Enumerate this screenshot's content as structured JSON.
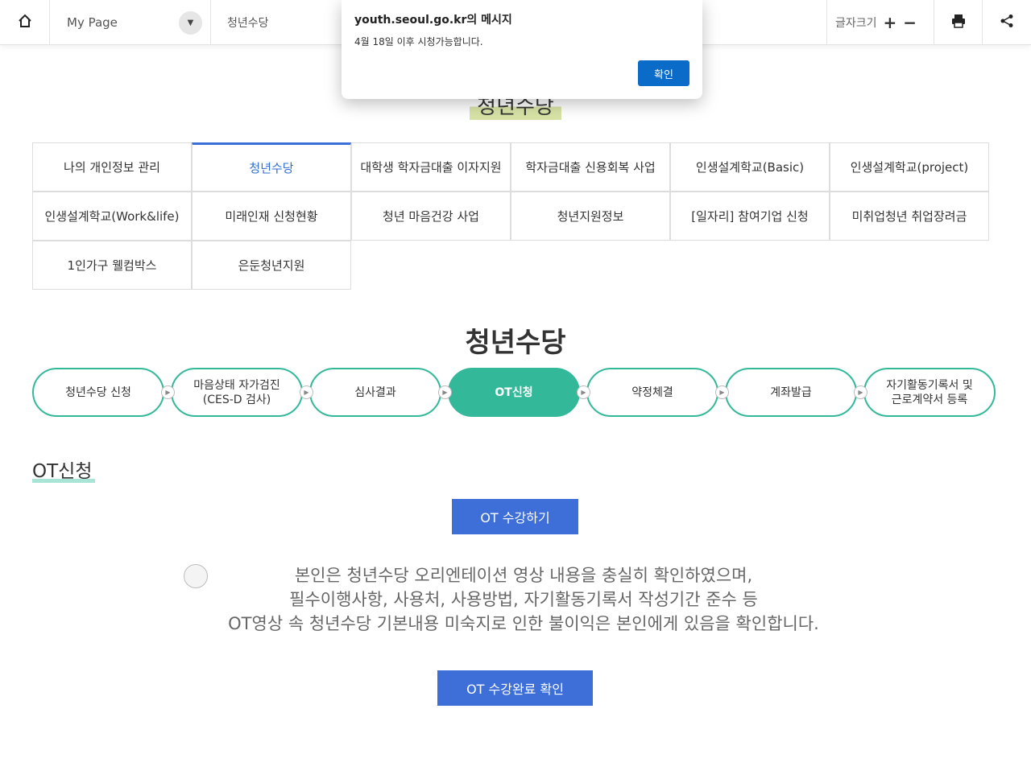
{
  "topbar": {
    "mypage_label": "My Page",
    "sub_label": "청년수당",
    "fontsize_label": "글자크기",
    "plus": "+",
    "minus": "−"
  },
  "page_title": "청년수당",
  "menu": [
    {
      "label": "나의 개인정보 관리",
      "active": false
    },
    {
      "label": "청년수당",
      "active": true
    },
    {
      "label": "대학생 학자금대출 이자지원",
      "active": false
    },
    {
      "label": "학자금대출 신용회복 사업",
      "active": false
    },
    {
      "label": "인생설계학교(Basic)",
      "active": false
    },
    {
      "label": "인생설계학교(project)",
      "active": false
    },
    {
      "label": "인생설계학교(Work&life)",
      "active": false
    },
    {
      "label": "미래인재 신청현황",
      "active": false
    },
    {
      "label": "청년 마음건강 사업",
      "active": false
    },
    {
      "label": "청년지원정보",
      "active": false
    },
    {
      "label": "[일자리] 참여기업 신청",
      "active": false
    },
    {
      "label": "미취업청년 취업장려금",
      "active": false
    },
    {
      "label": "1인가구 웰컴박스",
      "active": false
    },
    {
      "label": "은둔청년지원",
      "active": false
    }
  ],
  "section_title": "청년수당",
  "steps": [
    {
      "line1": "청년수당 신청",
      "line2": "",
      "active": false
    },
    {
      "line1": "마음상태 자가검진",
      "line2": "(CES-D 검사)",
      "active": false
    },
    {
      "line1": "심사결과",
      "line2": "",
      "active": false
    },
    {
      "line1": "OT신청",
      "line2": "",
      "active": true
    },
    {
      "line1": "약정체결",
      "line2": "",
      "active": false
    },
    {
      "line1": "계좌발급",
      "line2": "",
      "active": false
    },
    {
      "line1": "자기활동기록서 및",
      "line2": "근로계약서 등록",
      "active": false
    }
  ],
  "sub_heading": "OT신청",
  "ot_button": "OT 수강하기",
  "confirm_text": {
    "line1": "본인은 청년수당 오리엔테이션 영상 내용을 충실히 확인하였으며,",
    "line2": "필수이행사항, 사용처, 사용방법, 자기활동기록서 작성기간 준수 등",
    "line3": "OT영상 속 청년수당 기본내용 미숙지로 인한 불이익은 본인에게 있음을 확인합니다."
  },
  "complete_button": "OT 수강완료 확인",
  "dialog": {
    "title": "youth.seoul.go.kr의 메시지",
    "message": "4월 18일 이후 시청가능합니다.",
    "ok": "확인"
  },
  "colors": {
    "accent_green": "#33b89a",
    "accent_blue": "#3e6fd9",
    "dialog_button": "#0b6bc9"
  }
}
